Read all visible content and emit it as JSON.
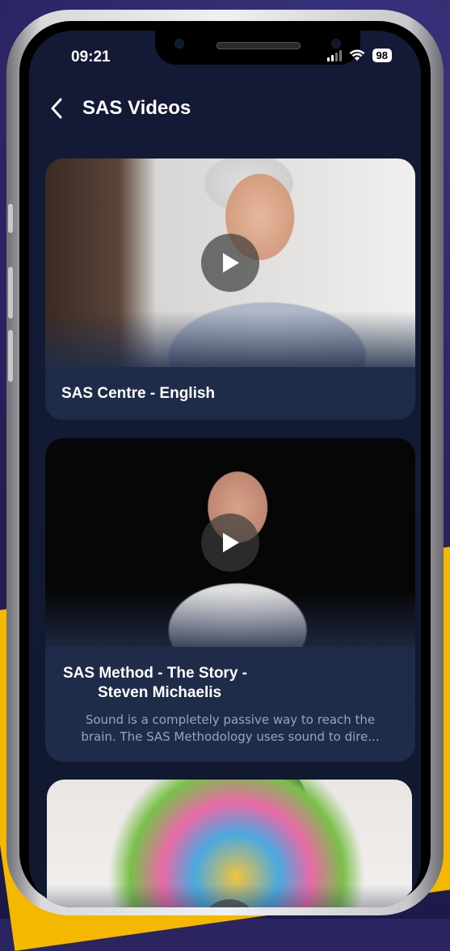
{
  "status_bar": {
    "time": "09:21",
    "battery": "98"
  },
  "header": {
    "title": "SAS Videos"
  },
  "videos": [
    {
      "title": "SAS Centre - English"
    },
    {
      "title_line1": "SAS Method - The Story -",
      "title_line2": "Steven Michaelis",
      "description_line1": "Sound is a completely passive way to reach the",
      "description_line2": "brain. The SAS Methodology uses sound to dire..."
    },
    {
      "title": ""
    }
  ],
  "icons": {
    "back": "chevron-left-icon",
    "play": "play-icon",
    "signal": "cellular-signal-icon",
    "wifi": "wifi-icon",
    "battery": "battery-icon"
  },
  "colors": {
    "screen_bg": "#121a35",
    "card_bg": "#1f2c49",
    "accent_yellow": "#f5b800",
    "outer_bg": "#2a2560"
  }
}
